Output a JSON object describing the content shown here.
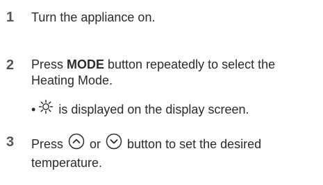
{
  "steps": [
    {
      "number": "1",
      "text": "Turn the appliance on."
    },
    {
      "number": "2",
      "text_prefix": "Press ",
      "text_bold": "MODE",
      "text_suffix": " button repeatedly to select the Heating Mode.",
      "bullet": "•",
      "note": " is displayed on the display screen.",
      "icon": "sun-icon"
    },
    {
      "number": "3",
      "text_prefix": "Press ",
      "text_or": " or ",
      "text_suffix": " button to set the desired temperature.",
      "up_icon": "chevron-up-circle-icon",
      "down_icon": "chevron-down-circle-icon"
    }
  ]
}
